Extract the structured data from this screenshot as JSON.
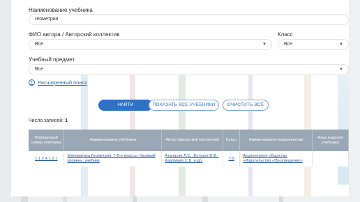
{
  "form": {
    "title_label": "Наименование учебника",
    "title_value": "геометрия",
    "author_label": "ФИО автора / Авторский коллектив",
    "author_value": "Все",
    "class_label": "Класс",
    "class_value": "Все",
    "subject_label": "Учебный предмет",
    "subject_value": "Все",
    "advanced_search": "Расширенный поиск"
  },
  "buttons": {
    "find": "НАЙТИ",
    "show_all": "ПОКАЗАТЬ ВСЕ УЧЕБНИКИ",
    "clear_all": "ОЧИСТИТЬ ВСЁ"
  },
  "results": {
    "count_label": "Число записей:",
    "count_value": "1"
  },
  "table": {
    "headers": {
      "num": "Порядковый номер учебника",
      "name": "Наименование учебника",
      "author": "Автор (авторский коллектив)",
      "class": "Класс",
      "publisher": "Наименование издательства",
      "language": "Язык издания учебника"
    },
    "row": {
      "num": "1.1.2.4.1.2.1",
      "name": "Математика.Геометрия. 7-9-е классы: базовый уровень: учебник",
      "author": "Атанасян Л.С., Бутузов В.Ф., Кадомцев С.Б. и др.",
      "class": "7-9",
      "publisher": "Акционерное общество «Издательство «Просвещение»",
      "language": ""
    }
  }
}
